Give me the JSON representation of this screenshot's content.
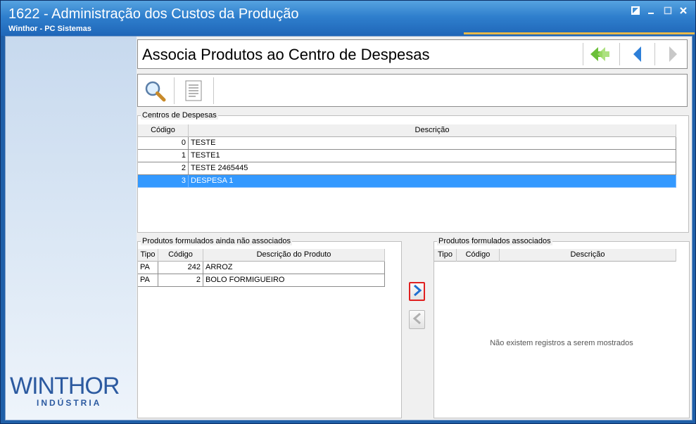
{
  "window": {
    "title": "1622 - Administração dos Custos da Produção",
    "subtitle": "Winthor - PC Sistemas",
    "controls": [
      "restore-icon",
      "minimize-icon",
      "maximize-icon",
      "close-icon"
    ]
  },
  "sidebar": {
    "logo_main": "WINTHOR",
    "logo_sub": "INDÚSTRIA"
  },
  "header": {
    "page_title": "Associa Produtos ao Centro de Despesas",
    "nav_icons": [
      "back-double-icon",
      "previous-icon",
      "next-icon"
    ]
  },
  "toolbar": {
    "tools": [
      "search-icon",
      "report-icon"
    ]
  },
  "centros": {
    "label": "Centros de Despesas",
    "columns": [
      "Código",
      "Descrição"
    ],
    "rows": [
      {
        "codigo": "0",
        "descricao": "TESTE"
      },
      {
        "codigo": "1",
        "descricao": "TESTE1"
      },
      {
        "codigo": "2",
        "descricao": "TESTE 2465445"
      },
      {
        "codigo": "3",
        "descricao": "DESPESA 1"
      }
    ],
    "selected_index": 3
  },
  "nao_associados": {
    "label": "Produtos formulados ainda não associados",
    "columns": [
      "Tipo",
      "Código",
      "Descrição do Produto"
    ],
    "rows": [
      {
        "tipo": "PA",
        "codigo": "242",
        "descricao": "ARROZ"
      },
      {
        "tipo": "PA",
        "codigo": "2",
        "descricao": "BOLO FORMIGUEIRO"
      }
    ]
  },
  "associados": {
    "label": "Produtos formulados associados",
    "columns": [
      "Tipo",
      "Código",
      "Descrição"
    ],
    "empty_message": "Não existem registros a serem mostrados"
  },
  "move_buttons": {
    "add_icon": "chevron-right-icon",
    "remove_icon": "chevron-left-icon"
  },
  "colors": {
    "titlebar": "#2f7fcd",
    "selection": "#3399ff",
    "accent_border": "#e02020"
  }
}
